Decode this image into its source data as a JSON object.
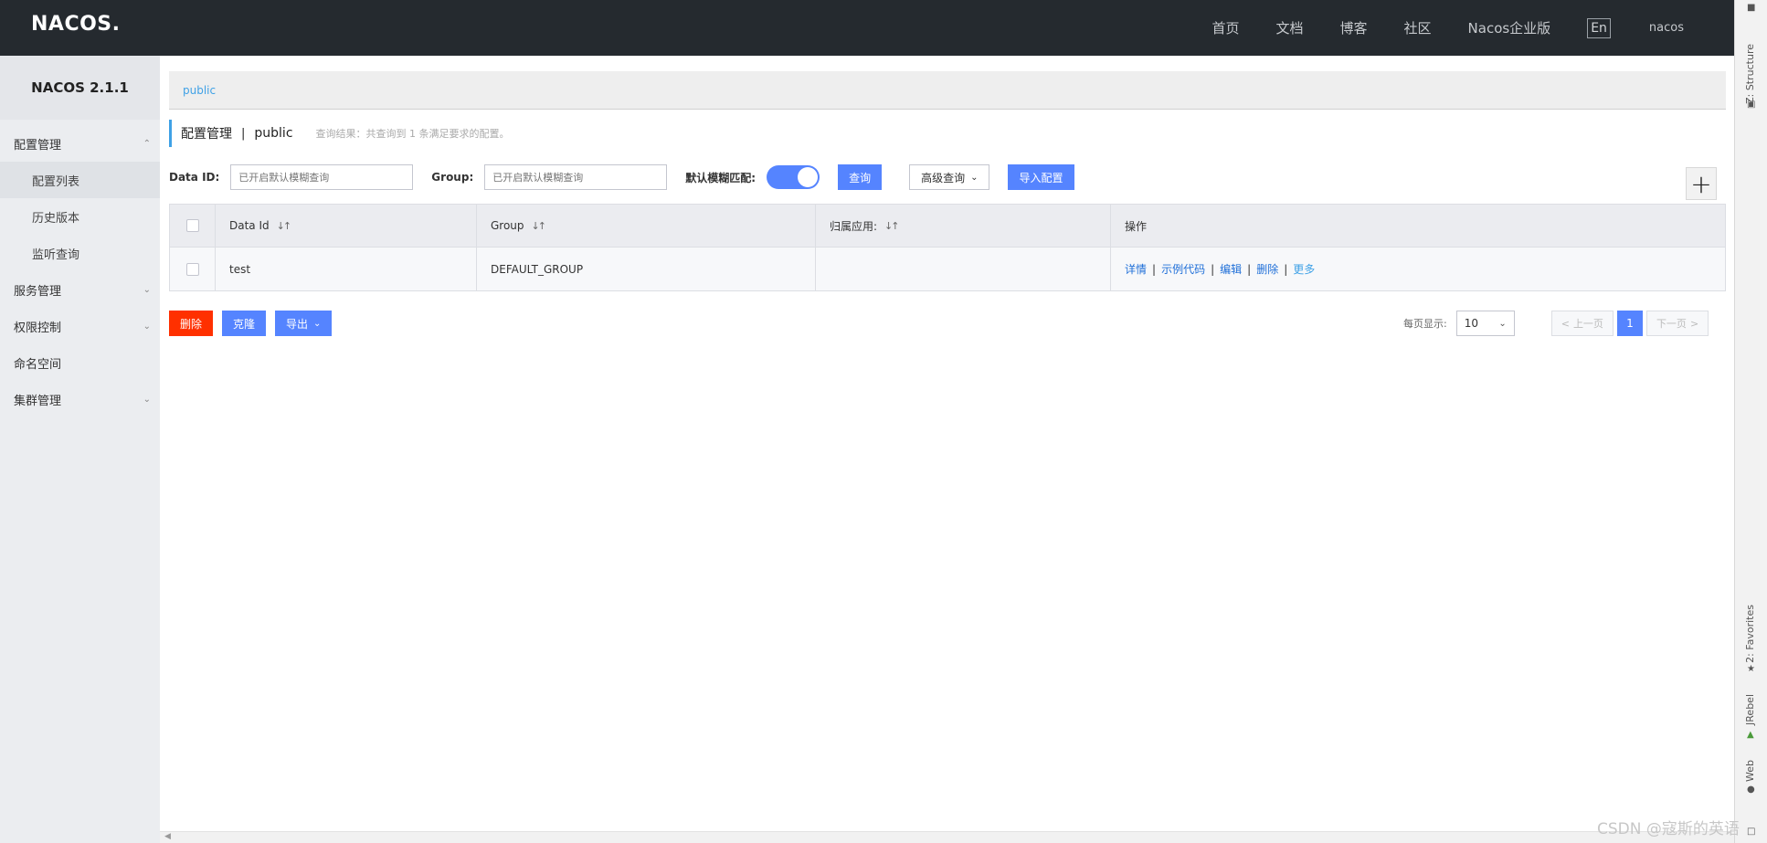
{
  "topbar": {
    "logo": "NACOS.",
    "nav": [
      "首页",
      "文档",
      "博客",
      "社区",
      "Nacos企业版"
    ],
    "lang": "En",
    "user": "nacos"
  },
  "ide": {
    "tabs": [
      "Z: Structure",
      "2: Favorites",
      "JRebel",
      "Web"
    ]
  },
  "sidebar": {
    "version": "NACOS 2.1.1",
    "items": [
      {
        "label": "配置管理",
        "type": "group",
        "expanded": true
      },
      {
        "label": "配置列表",
        "type": "sub",
        "active": true
      },
      {
        "label": "历史版本",
        "type": "sub"
      },
      {
        "label": "监听查询",
        "type": "sub"
      },
      {
        "label": "服务管理",
        "type": "group",
        "expanded": false
      },
      {
        "label": "权限控制",
        "type": "group",
        "expanded": false
      },
      {
        "label": "命名空间",
        "type": "item"
      },
      {
        "label": "集群管理",
        "type": "group",
        "expanded": false
      }
    ]
  },
  "namespace_bar": {
    "active": "public"
  },
  "page_head": {
    "title": "配置管理",
    "sep": "|",
    "namespace": "public",
    "result": "查询结果：共查询到 1 条满足要求的配置。"
  },
  "search": {
    "data_id_label": "Data ID:",
    "data_id_placeholder": "已开启默认模糊查询",
    "group_label": "Group:",
    "group_placeholder": "已开启默认模糊查询",
    "fuzzy_label": "默认模糊匹配:",
    "fuzzy_on": true,
    "query_button": "查询",
    "advanced_button": "高级查询",
    "import_button": "导入配置"
  },
  "table": {
    "columns": [
      "Data Id",
      "Group",
      "归属应用:",
      "操作"
    ],
    "rows": [
      {
        "data_id": "test",
        "group": "DEFAULT_GROUP",
        "app": "",
        "ops": [
          "详情",
          "示例代码",
          "编辑",
          "删除",
          "更多"
        ]
      }
    ]
  },
  "actions": {
    "delete": "删除",
    "clone": "克隆",
    "export": "导出"
  },
  "pagination": {
    "page_size_label": "每页显示:",
    "page_size": "10",
    "prev": "上一页",
    "next": "下一页",
    "current": "1"
  },
  "watermark": "CSDN @寇斯的英语",
  "colors": {
    "topbar_bg": "#252a2f",
    "primary": "#5584ff",
    "danger": "#ff3000",
    "link": "#1f6fd8",
    "accent": "#3fa1e6"
  }
}
